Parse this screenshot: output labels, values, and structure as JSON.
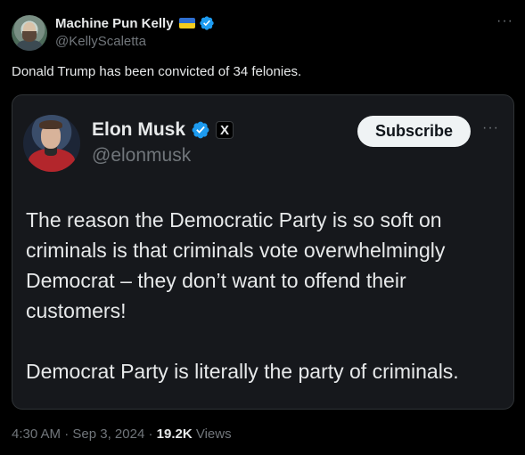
{
  "author": {
    "display_name": "Machine Pun Kelly",
    "handle": "@KellyScaletta",
    "colors": {
      "flag_blue": "#2f6fd1",
      "flag_yellow": "#f5cd1d",
      "verified": "#1d9bf0"
    }
  },
  "more_label": "···",
  "tweet": {
    "text": "Donald Trump has been convicted of 34 felonies."
  },
  "quoted": {
    "display_name": "Elon Musk",
    "handle": "@elonmusk",
    "badge_label": "X",
    "subscribe_label": "Subscribe",
    "paragraphs": [
      "The reason the Democratic Party is so soft on criminals is that criminals vote overwhelmingly Democrat – they don’t want to offend their customers!",
      "Democrat Party is literally the party of criminals."
    ]
  },
  "meta": {
    "time": "4:30 AM",
    "separator": "·",
    "date": "Sep 3, 2024",
    "views_count": "19.2K",
    "views_label": "Views"
  }
}
